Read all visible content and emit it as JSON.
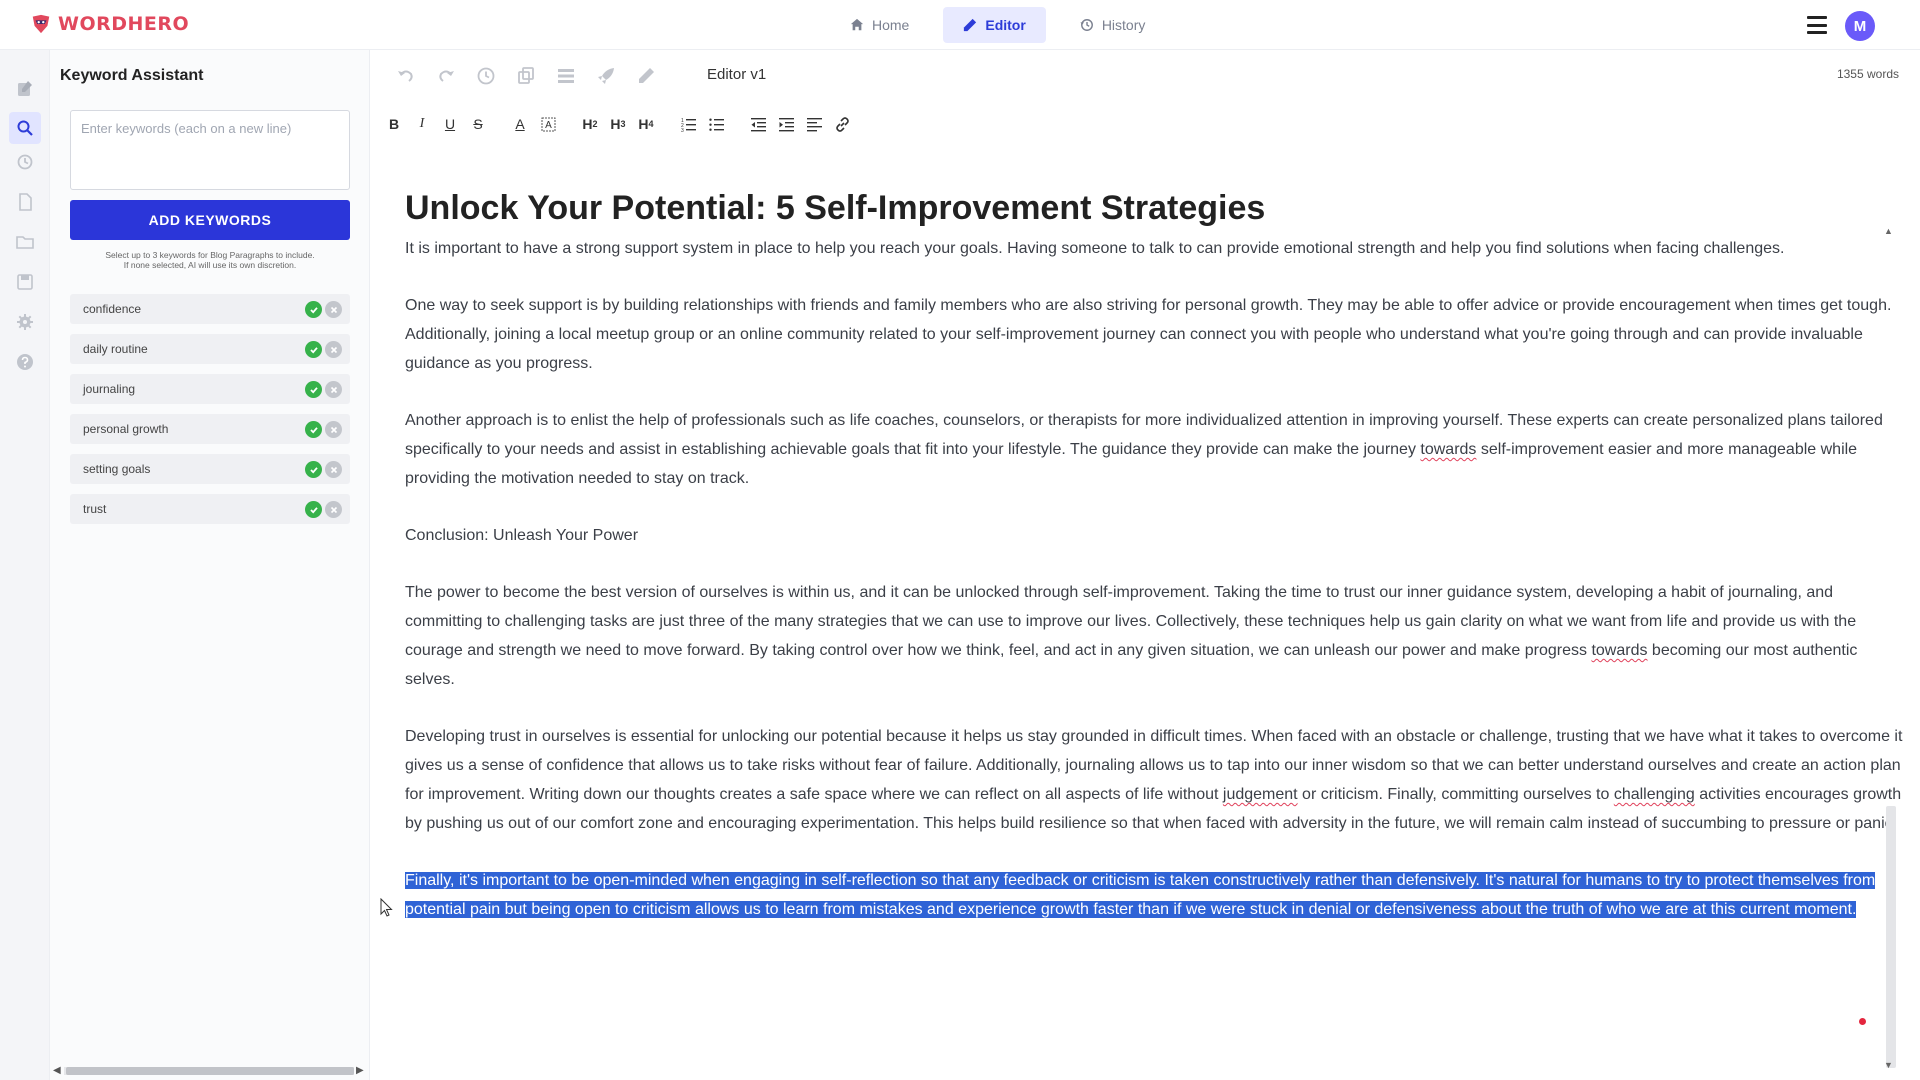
{
  "brand": {
    "name": "WORDHERO",
    "accent": "#e1485d"
  },
  "nav": {
    "items": [
      {
        "label": "Home",
        "icon": "home-icon"
      },
      {
        "label": "Editor",
        "icon": "pencil-icon",
        "active": true
      },
      {
        "label": "History",
        "icon": "history-icon"
      }
    ]
  },
  "user": {
    "initial": "M",
    "color": "#6a5af9"
  },
  "keyword_panel": {
    "title": "Keyword Assistant",
    "input_placeholder": "Enter keywords (each on a new line)",
    "add_button": "ADD KEYWORDS",
    "hint_line1": "Select up to 3 keywords for Blog Paragraphs to include.",
    "hint_line2": "If none selected, AI will use its own discretion.",
    "keywords": [
      "confidence",
      "daily routine",
      "journaling",
      "personal growth",
      "setting goals",
      "trust"
    ]
  },
  "editor": {
    "version": "Editor v1",
    "word_count": "1355 words",
    "title": "Unlock Your Potential: 5 Self-Improvement Strategies",
    "p1": "It is important to have a strong support system in place to help you reach your goals. Having someone to talk to can provide emotional strength and help you find solutions when facing challenges.",
    "p2": "One way to seek support is by building relationships with friends and family members who are also striving for personal growth. They may be able to offer advice or provide encouragement when times get tough. Additionally, joining a local meetup group or an online community related to your self-improvement journey can connect you with people who understand what you're going through and can provide invaluable guidance as you progress.",
    "p3_a": "Another approach is to enlist the help of professionals such as life coaches, counselors, or therapists for more individualized attention in improving yourself. These experts can create personalized plans tailored specifically to your needs and assist in establishing achievable goals that fit into your lifestyle. The guidance they provide can make the journey ",
    "p3_word": "towards",
    "p3_b": " self-improvement easier and more manageable while providing the motivation needed to stay on track.",
    "conclusion_heading": "Conclusion: Unleash Your Power",
    "p4_a": "The power to become the best version of ourselves is within us, and it can be unlocked through self-improvement. Taking the time to trust our inner guidance system, developing a habit of journaling, and committing to challenging tasks are just three of the many strategies that we can use to improve our lives. Collectively, these techniques help us gain clarity on what we want from life and provide us with the courage and strength we need to move forward. By taking control over how we think, feel, and act in any given situation, we can unleash our power and make progress ",
    "p4_word": "towards",
    "p4_b": " becoming our most authentic selves.",
    "p5_a": "Developing trust in ourselves is essential for unlocking our potential because it helps us stay grounded in difficult times. When faced with an obstacle or challenge, trusting that we have what it takes to overcome it gives us a sense of confidence that allows us to take risks without fear of failure. Additionally, journaling allows us to tap into our inner wisdom so that we can better understand ourselves and create an action plan for improvement. Writing down our thoughts creates a safe space where we can reflect on all aspects of life without ",
    "p5_word1": "judgement",
    "p5_b": " or criticism. Finally, committing ourselves to ",
    "p5_word2": "challenging",
    "p5_c": " activities encourages growth by pushing us out of our comfort zone and encouraging experimentation. This helps build resilience so that when faced with adversity in the future, we will remain calm instead of succumbing to pressure or panic.",
    "p6_selected": "Finally, it's important to be open-minded when engaging in self-reflection so that any feedback or criticism is taken constructively rather than defensively. It's natural for humans to try to protect themselves from potential pain but being open to criticism allows us to learn from mistakes and experience growth faster than if we were stuck in denial or defensiveness about the truth of who we are at this current moment."
  },
  "colors": {
    "primary_button": "#2b36d9",
    "selection": "#2f63d6",
    "ok_green": "#36b24a"
  }
}
